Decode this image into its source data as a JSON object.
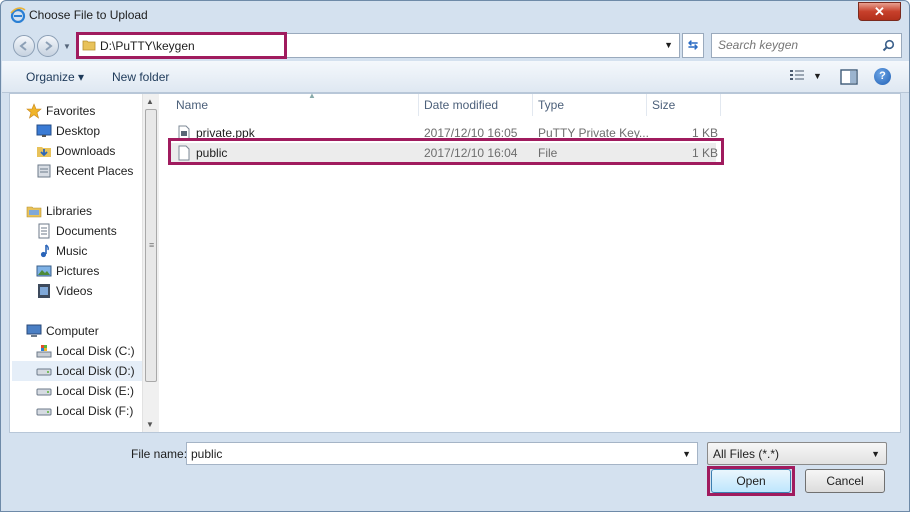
{
  "window": {
    "title": "Choose File to Upload",
    "close_glyph": "✕"
  },
  "nav": {
    "address_path": "D:\\PuTTY\\keygen",
    "search_placeholder": "Search keygen"
  },
  "toolbar": {
    "organize_label": "Organize ▾",
    "new_folder_label": "New folder",
    "help_glyph": "?"
  },
  "navpane": {
    "items": [
      {
        "label": "Favorites",
        "icon": "star-icon"
      },
      {
        "label": "Desktop",
        "icon": "desktop-icon"
      },
      {
        "label": "Downloads",
        "icon": "downloads-icon"
      },
      {
        "label": "Recent Places",
        "icon": "recent-places-icon"
      },
      {
        "label": "Libraries",
        "icon": "libraries-icon"
      },
      {
        "label": "Documents",
        "icon": "documents-icon"
      },
      {
        "label": "Music",
        "icon": "music-icon"
      },
      {
        "label": "Pictures",
        "icon": "pictures-icon"
      },
      {
        "label": "Videos",
        "icon": "videos-icon"
      },
      {
        "label": "Computer",
        "icon": "computer-icon"
      },
      {
        "label": "Local Disk (C:)",
        "icon": "system-drive-icon"
      },
      {
        "label": "Local Disk (D:)",
        "icon": "drive-icon"
      },
      {
        "label": "Local Disk (E:)",
        "icon": "drive-icon"
      },
      {
        "label": "Local Disk (F:)",
        "icon": "drive-icon"
      }
    ],
    "selected": "Local Disk (D:)"
  },
  "files": {
    "columns": [
      "Name",
      "Date modified",
      "Type",
      "Size"
    ],
    "rows": [
      {
        "name": "private.ppk",
        "date": "2017/12/10 16:05",
        "type": "PuTTY Private Key...",
        "size": "1 KB"
      },
      {
        "name": "public",
        "date": "2017/12/10 16:04",
        "type": "File",
        "size": "1 KB"
      }
    ]
  },
  "footer": {
    "file_name_label": "File name:",
    "file_name_value": "public",
    "file_type_value": "All Files (*.*)",
    "open_label": "Open",
    "cancel_label": "Cancel"
  }
}
